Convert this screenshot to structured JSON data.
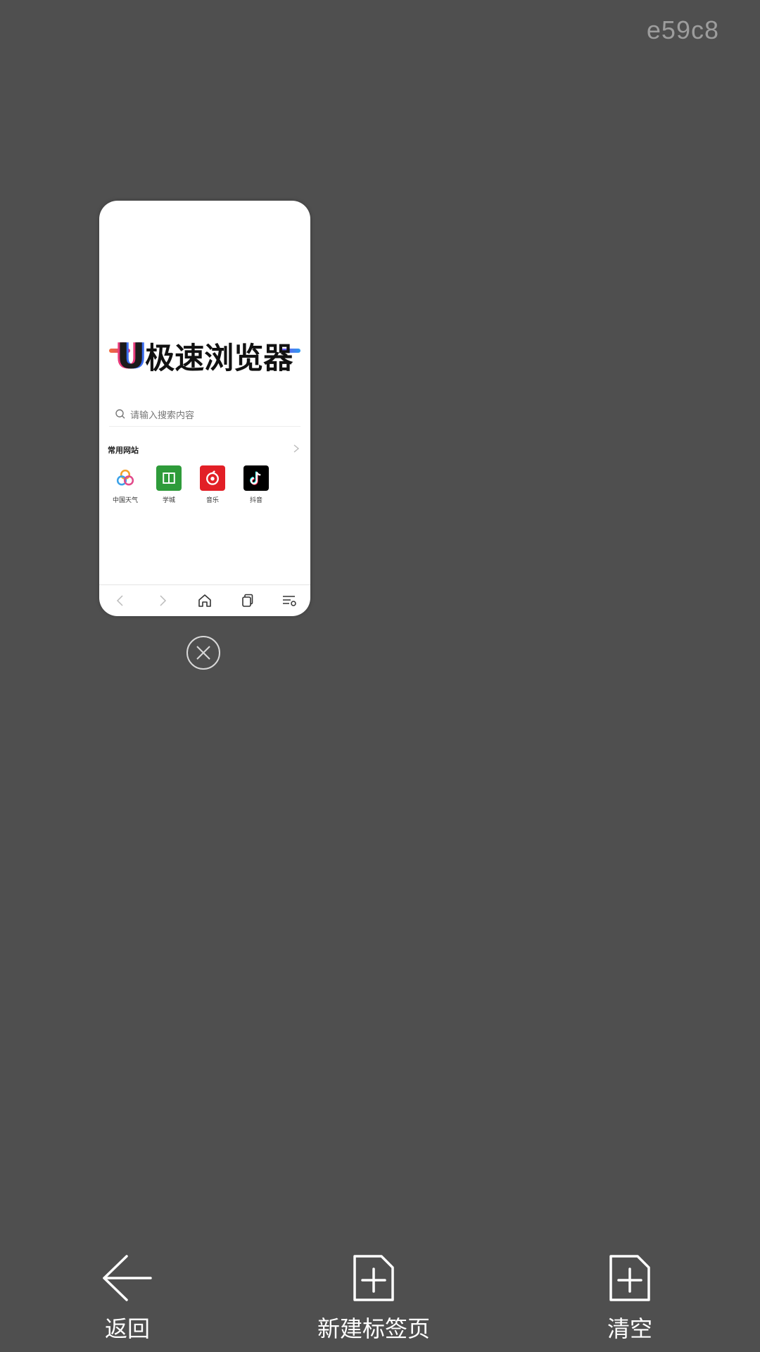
{
  "top_label": "e59c8",
  "tab": {
    "logo_letter": "U",
    "logo_text": "极速浏览器",
    "search_placeholder": "请输入搜索内容",
    "section_title": "常用网站",
    "sites": [
      {
        "label": "中国天气",
        "icon": "weather-pinwheel-icon",
        "color": "#ffffff"
      },
      {
        "label": "学城",
        "icon": "xuecheng-icon",
        "color": "#2e9b3a"
      },
      {
        "label": "音乐",
        "icon": "netease-music-icon",
        "color": "#e21f26"
      },
      {
        "label": "抖音",
        "icon": "douyin-icon",
        "color": "#000000"
      }
    ]
  },
  "toolbar": {
    "back_label": "返回",
    "new_tab_label": "新建标签页",
    "clear_label": "清空"
  },
  "colors": {
    "background": "#4f4f4f",
    "top_label": "#9d9d9d"
  }
}
